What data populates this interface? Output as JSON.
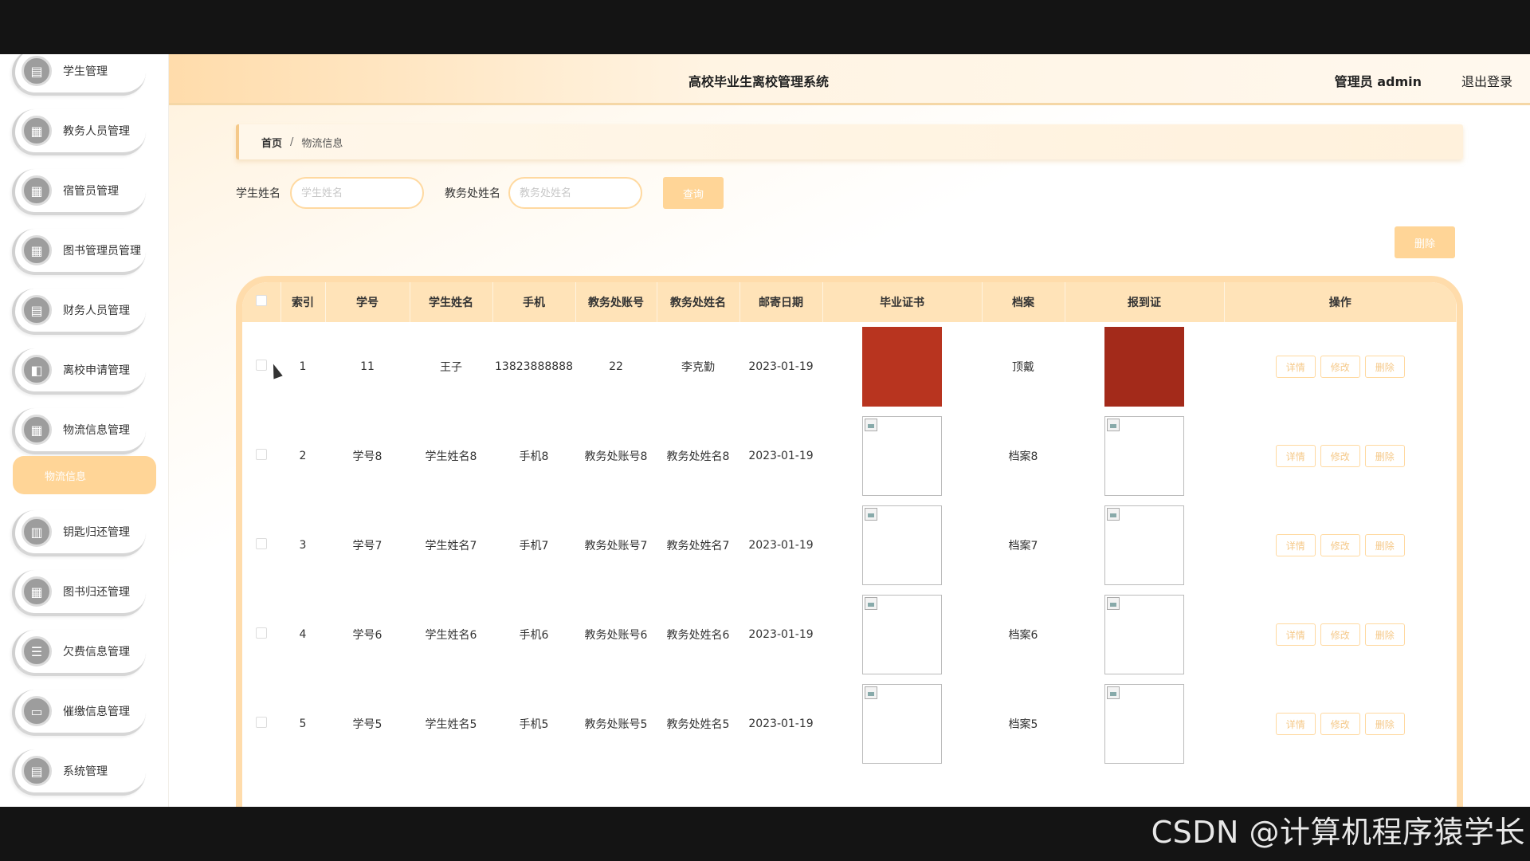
{
  "app_title": "高校毕业生离校管理系统",
  "user_label": "管理员 admin",
  "logout_label": "退出登录",
  "sidebar": {
    "items": [
      {
        "label": "学生管理",
        "icon": "doc-icon"
      },
      {
        "label": "教务人员管理",
        "icon": "grid-icon"
      },
      {
        "label": "宿管员管理",
        "icon": "grid-icon"
      },
      {
        "label": "图书管理员管理",
        "icon": "grid-icon"
      },
      {
        "label": "财务人员管理",
        "icon": "doc-icon"
      },
      {
        "label": "离校申请管理",
        "icon": "chart-icon"
      },
      {
        "label": "物流信息管理",
        "icon": "grid-icon"
      },
      {
        "label": "钥匙归还管理",
        "icon": "bar-icon"
      },
      {
        "label": "图书归还管理",
        "icon": "grid-icon"
      },
      {
        "label": "欠费信息管理",
        "icon": "list-icon"
      },
      {
        "label": "催缴信息管理",
        "icon": "monitor-icon"
      },
      {
        "label": "系统管理",
        "icon": "doc-icon"
      }
    ],
    "active_sub": "物流信息"
  },
  "breadcrumb": {
    "home": "首页",
    "sep": "/",
    "current": "物流信息"
  },
  "search": {
    "student_label": "学生姓名",
    "student_placeholder": "学生姓名",
    "office_label": "教务处姓名",
    "office_placeholder": "教务处姓名",
    "query_label": "查询",
    "delete_label": "删除"
  },
  "table": {
    "headers": [
      "",
      "索引",
      "学号",
      "学生姓名",
      "手机",
      "教务处账号",
      "教务处姓名",
      "邮寄日期",
      "毕业证书",
      "档案",
      "报到证",
      "操作"
    ],
    "rows": [
      {
        "index": "1",
        "student_no": "11",
        "name": "王子",
        "phone": "13823888888",
        "office_account": "22",
        "office_name": "李克勤",
        "date": "2023-01-19",
        "archive": "顶戴"
      },
      {
        "index": "2",
        "student_no": "学号8",
        "name": "学生姓名8",
        "phone": "手机8",
        "office_account": "教务处账号8",
        "office_name": "教务处姓名8",
        "date": "2023-01-19",
        "archive": "档案8"
      },
      {
        "index": "3",
        "student_no": "学号7",
        "name": "学生姓名7",
        "phone": "手机7",
        "office_account": "教务处账号7",
        "office_name": "教务处姓名7",
        "date": "2023-01-19",
        "archive": "档案7"
      },
      {
        "index": "4",
        "student_no": "学号6",
        "name": "学生姓名6",
        "phone": "手机6",
        "office_account": "教务处账号6",
        "office_name": "教务处姓名6",
        "date": "2023-01-19",
        "archive": "档案6"
      },
      {
        "index": "5",
        "student_no": "学号5",
        "name": "学生姓名5",
        "phone": "手机5",
        "office_account": "教务处账号5",
        "office_name": "教务处姓名5",
        "date": "2023-01-19",
        "archive": "档案5"
      }
    ],
    "ops": [
      "详情",
      "修改",
      "删除"
    ]
  },
  "watermark": "CSDN @计算机程序猿学长",
  "colors": {
    "accent": "#ffd597",
    "header": "#ffdcab",
    "table_header": "#ffe3b8"
  }
}
